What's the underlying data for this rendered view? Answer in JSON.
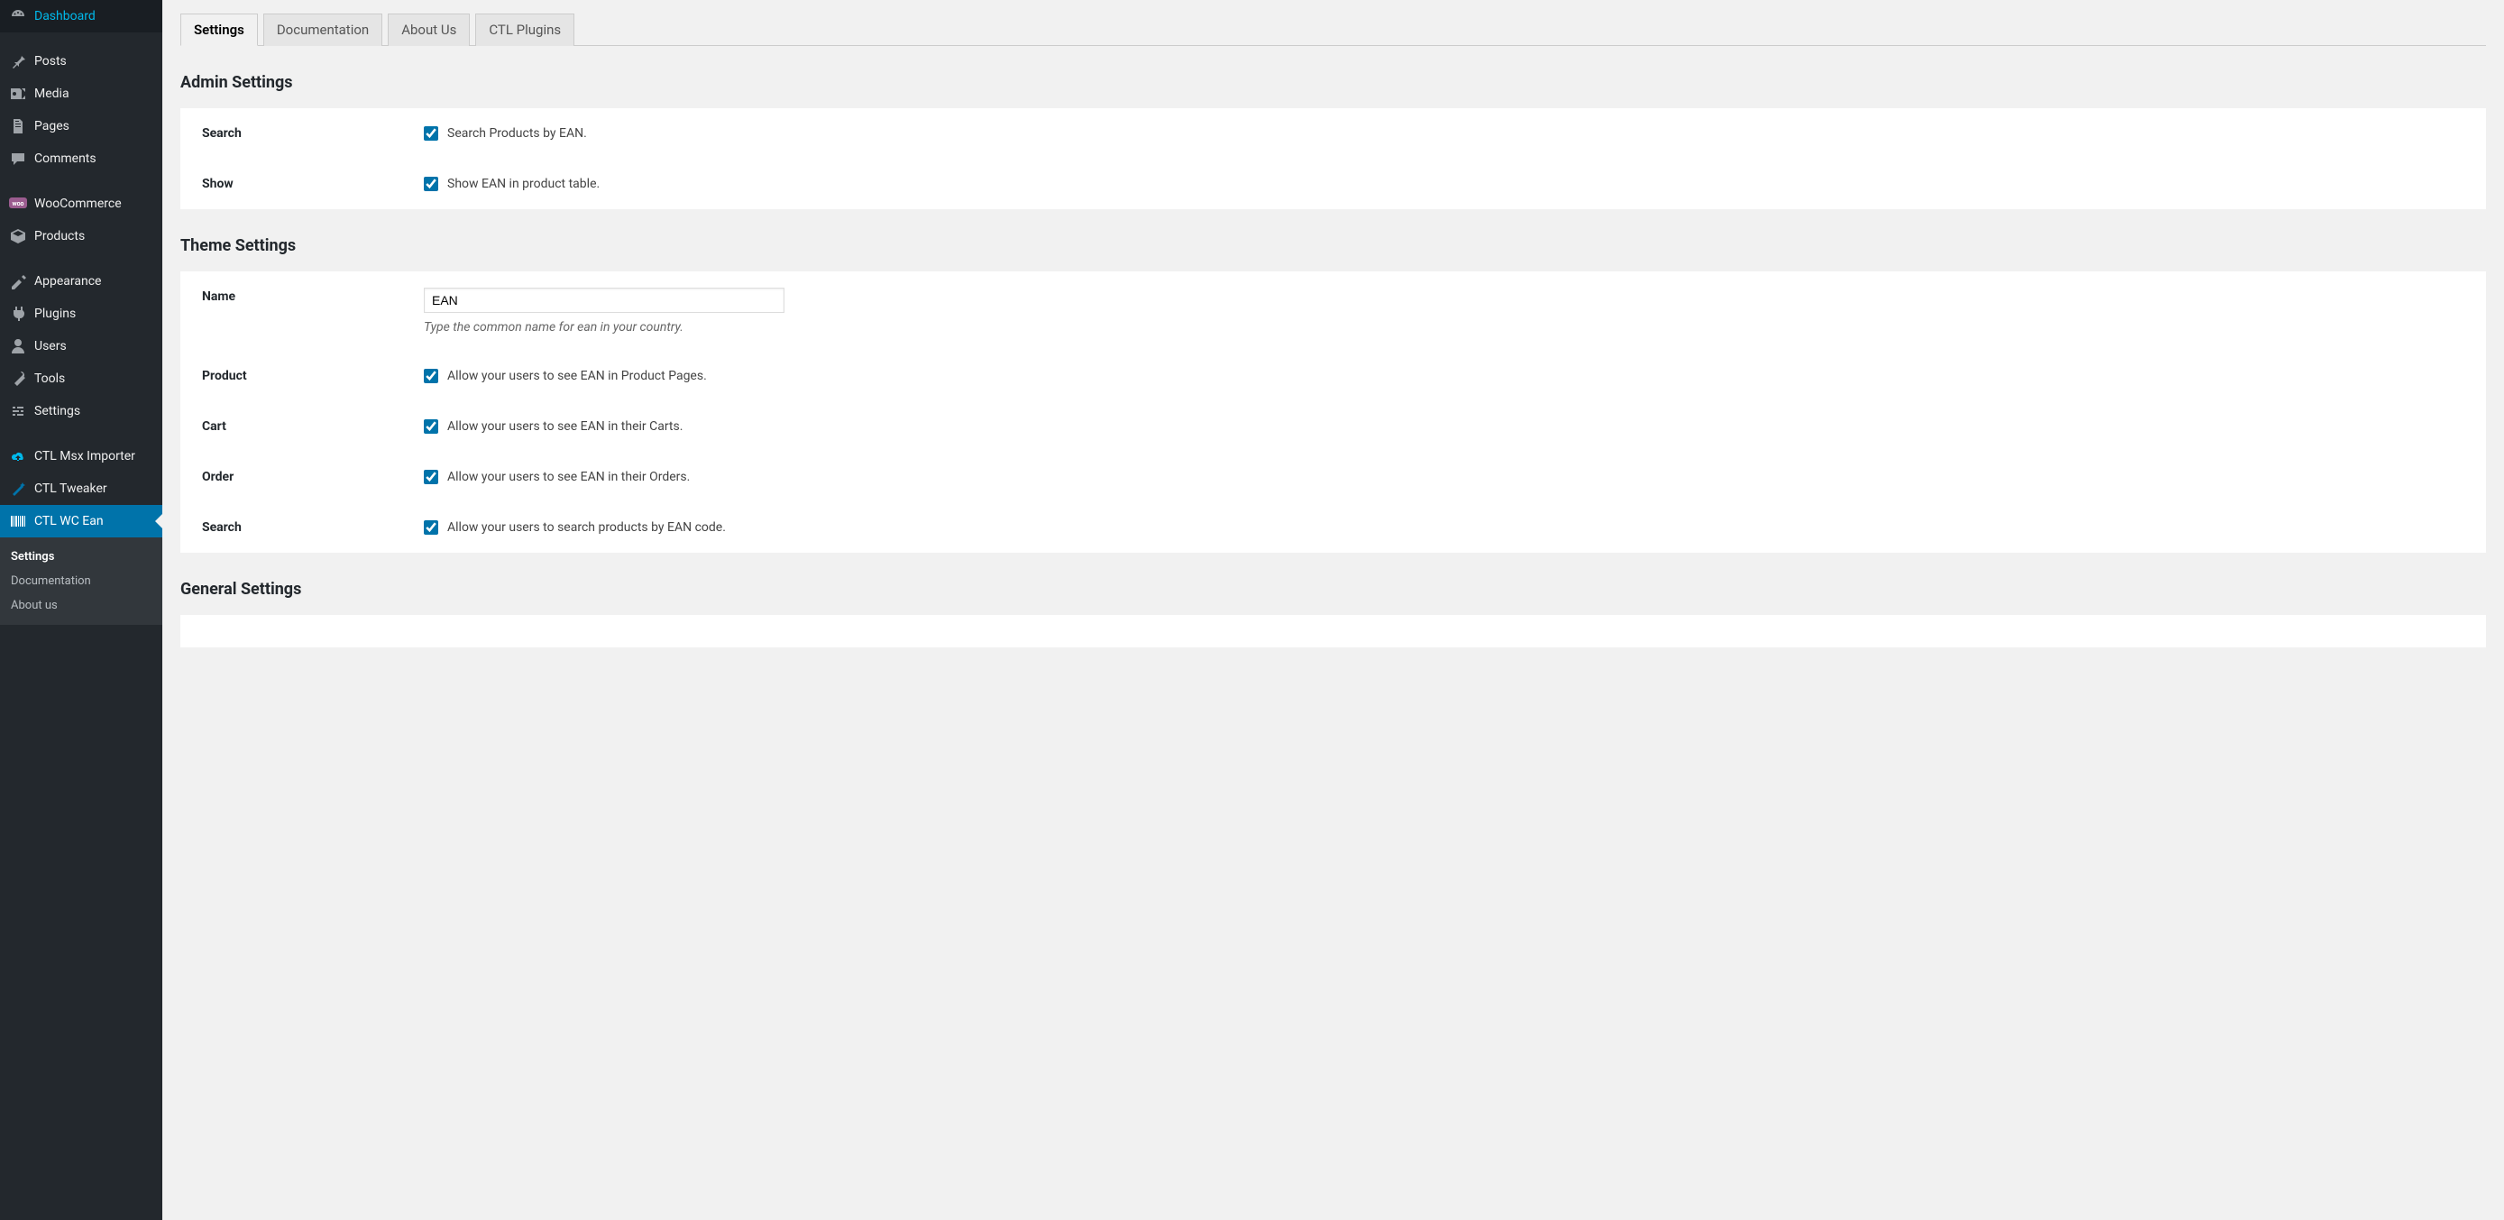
{
  "sidebar": {
    "items": [
      {
        "label": "Dashboard",
        "icon": "dashboard"
      },
      {
        "label": "Posts",
        "icon": "pin"
      },
      {
        "label": "Media",
        "icon": "media"
      },
      {
        "label": "Pages",
        "icon": "pages"
      },
      {
        "label": "Comments",
        "icon": "comments"
      },
      {
        "label": "WooCommerce",
        "icon": "woo"
      },
      {
        "label": "Products",
        "icon": "products"
      },
      {
        "label": "Appearance",
        "icon": "appearance"
      },
      {
        "label": "Plugins",
        "icon": "plugins"
      },
      {
        "label": "Users",
        "icon": "users"
      },
      {
        "label": "Tools",
        "icon": "tools"
      },
      {
        "label": "Settings",
        "icon": "settings"
      },
      {
        "label": "CTL Msx Importer",
        "icon": "cloud"
      },
      {
        "label": "CTL Tweaker",
        "icon": "wand"
      },
      {
        "label": "CTL WC Ean",
        "icon": "barcode",
        "current": true
      }
    ],
    "submenu": [
      {
        "label": "Settings",
        "current": true
      },
      {
        "label": "Documentation"
      },
      {
        "label": "About us"
      }
    ]
  },
  "tabs": [
    {
      "label": "Settings",
      "active": true
    },
    {
      "label": "Documentation"
    },
    {
      "label": "About Us"
    },
    {
      "label": "CTL Plugins"
    }
  ],
  "sections": {
    "admin": {
      "title": "Admin Settings",
      "rows": {
        "search": {
          "label": "Search",
          "text": "Search Products by EAN.",
          "checked": true
        },
        "show": {
          "label": "Show",
          "text": "Show EAN in product table.",
          "checked": true
        }
      }
    },
    "theme": {
      "title": "Theme Settings",
      "rows": {
        "name": {
          "label": "Name",
          "value": "EAN",
          "description": "Type the common name for ean in your country."
        },
        "product": {
          "label": "Product",
          "text": "Allow your users to see EAN in Product Pages.",
          "checked": true
        },
        "cart": {
          "label": "Cart",
          "text": "Allow your users to see EAN in their Carts.",
          "checked": true
        },
        "order": {
          "label": "Order",
          "text": "Allow your users to see EAN in their Orders.",
          "checked": true
        },
        "search": {
          "label": "Search",
          "text": "Allow your users to search products by EAN code.",
          "checked": true
        }
      }
    },
    "general": {
      "title": "General Settings"
    }
  }
}
